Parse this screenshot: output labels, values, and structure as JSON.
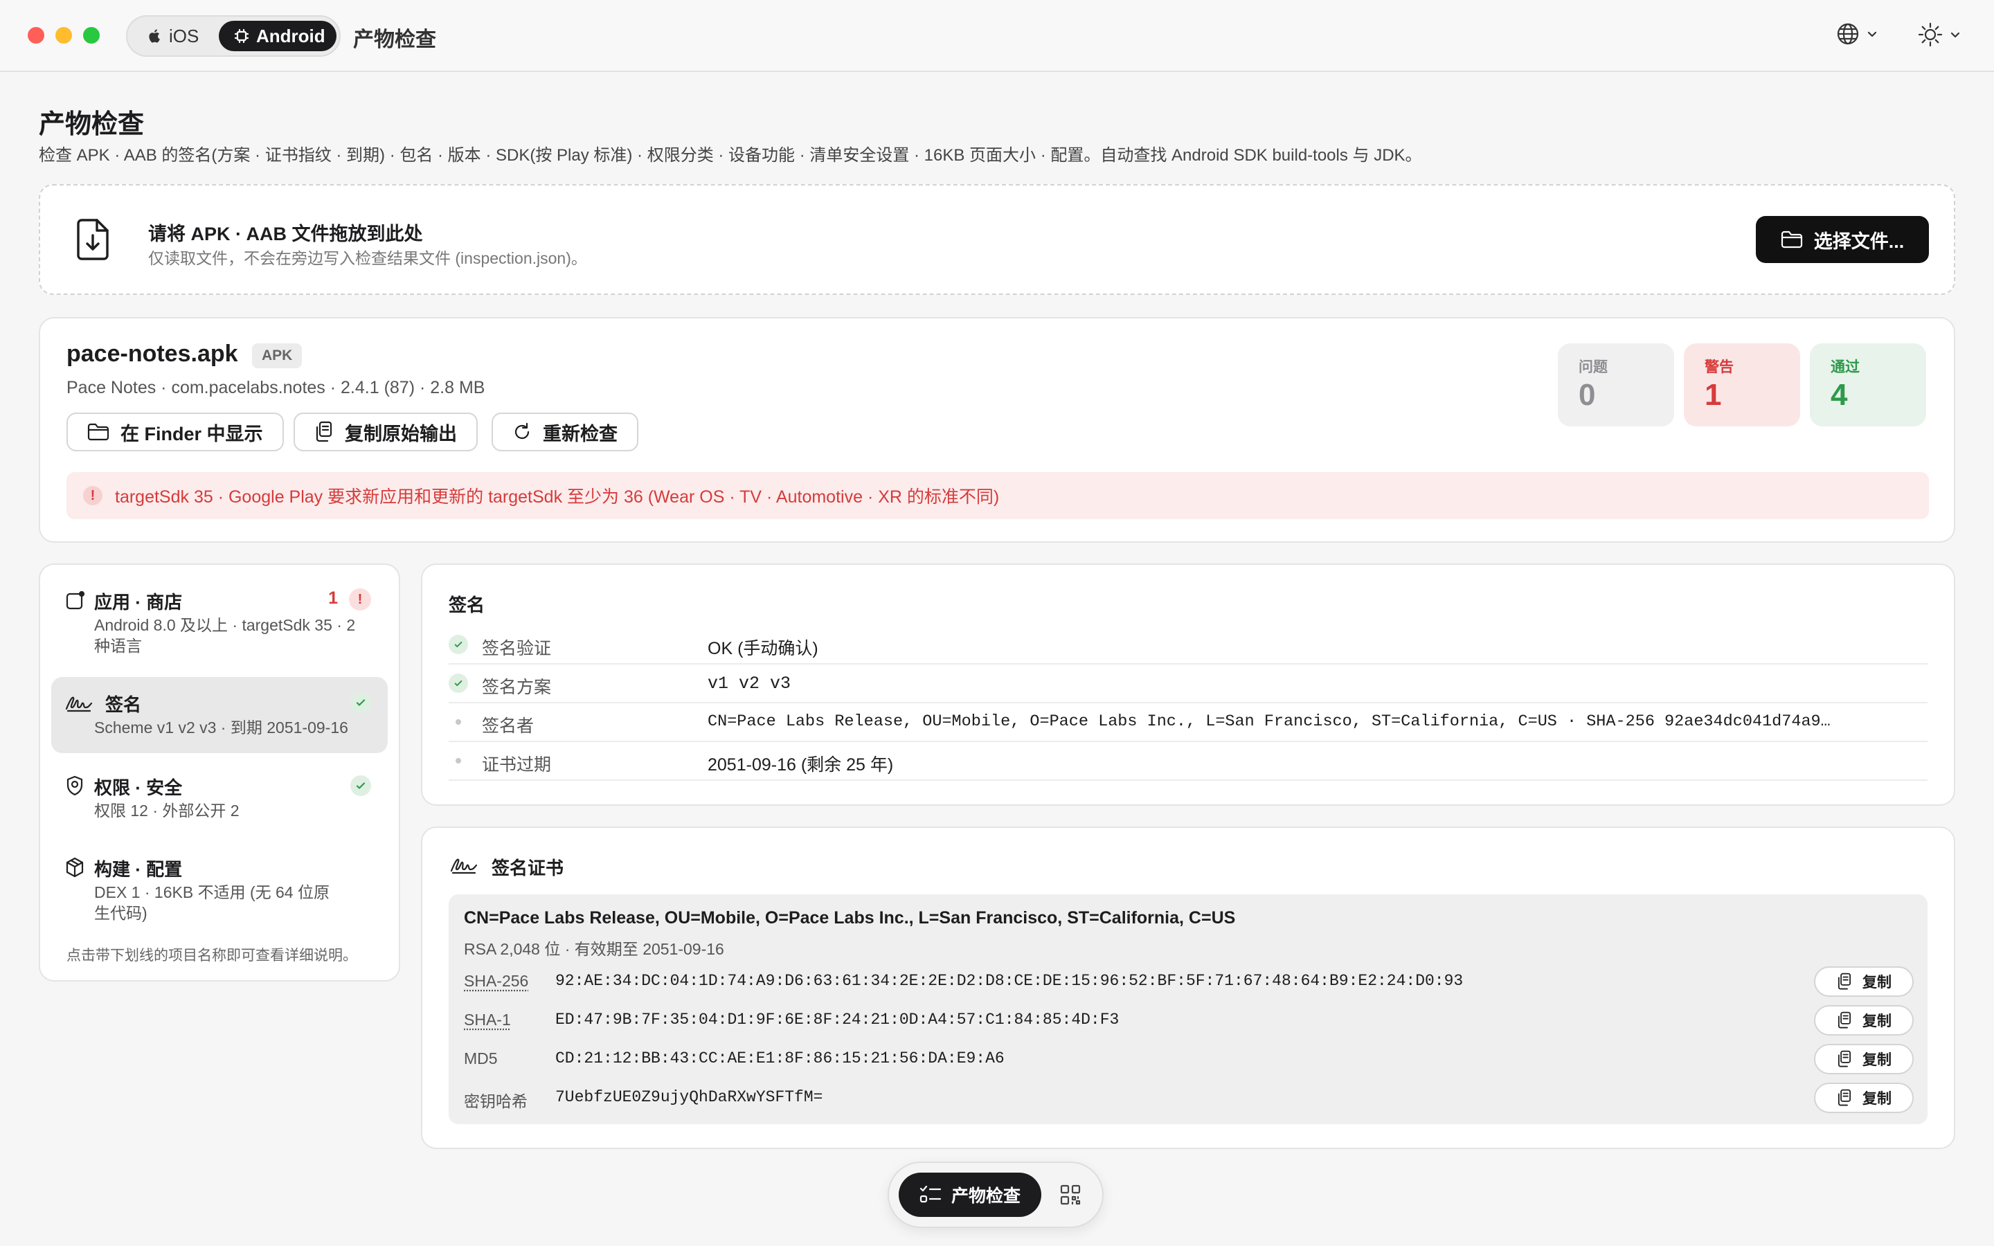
{
  "titlebar": {
    "platforms": [
      {
        "label": "iOS"
      },
      {
        "label": "Android"
      }
    ],
    "active_platform": "Android",
    "title": "产物检查"
  },
  "header": {
    "title": "产物检查",
    "subtitle": "检查 APK · AAB 的签名(方案 · 证书指纹 · 到期) · 包名 · 版本 · SDK(按 Play 标准) · 权限分类 · 设备功能 · 清单安全设置 · 16KB 页面大小 · 配置。自动查找 Android SDK build-tools 与 JDK。"
  },
  "dropzone": {
    "title": "请将 APK · AAB 文件拖放到此处",
    "hint": "仅读取文件，不会在旁边写入检查结果文件 (inspection.json)。",
    "choose_label": "选择文件..."
  },
  "file": {
    "name": "pace-notes.apk",
    "badge": "APK",
    "meta": "Pace Notes · com.pacelabs.notes · 2.4.1 (87) · 2.8 MB",
    "actions": {
      "reveal": "在 Finder 中显示",
      "copy_raw": "复制原始输出",
      "recheck": "重新检查"
    },
    "stats": {
      "issues": {
        "label": "问题",
        "value": "0",
        "color": "#8e8e93"
      },
      "warnings": {
        "label": "警告",
        "value": "1",
        "color": "#d63b3b"
      },
      "passed": {
        "label": "通过",
        "value": "4",
        "color": "#2c9a4a"
      }
    },
    "alert": "targetSdk 35 · Google Play 要求新应用和更新的 targetSdk 至少为 36 (Wear OS · TV · Automotive · XR 的标准不同)"
  },
  "sidebar": {
    "items": [
      {
        "title": "应用 · 商店",
        "sub": "Android 8.0 及以上 · targetSdk 35 · 2 种语言",
        "badge_count": "1",
        "status": "warning",
        "icon": "app-store-icon"
      },
      {
        "title": "签名",
        "sub": "Scheme v1 v2 v3 · 到期 2051-09-16",
        "status": "ok",
        "icon": "signature-icon"
      },
      {
        "title": "权限 · 安全",
        "sub": "权限 12 · 外部公开 2",
        "status": "ok",
        "icon": "shield-icon"
      },
      {
        "title": "构建 · 配置",
        "sub": "DEX 1 · 16KB 不适用 (无 64 位原生代码)",
        "status": "none",
        "icon": "box-icon"
      }
    ],
    "footer": "点击带下划线的项目名称即可查看详细说明。"
  },
  "signature": {
    "heading": "签名",
    "rows": [
      {
        "key": "签名验证",
        "value": "OK (手动确认)",
        "status": "ok"
      },
      {
        "key": "签名方案",
        "value": "v1  v2  v3",
        "status": "ok"
      },
      {
        "key": "签名者",
        "value": "CN=Pace Labs Release, OU=Mobile, O=Pace Labs Inc., L=San Francisco, ST=California, C=US · SHA-256 92ae34dc041d74a9…",
        "status": "info"
      },
      {
        "key": "证书过期",
        "value": "2051-09-16 (剩余 25 年)",
        "status": "info"
      }
    ]
  },
  "certificate": {
    "heading": "签名证书",
    "subject": "CN=Pace Labs Release, OU=Mobile, O=Pace Labs Inc., L=San Francisco, ST=California, C=US",
    "info": "RSA 2,048 位 · 有效期至 2051-09-16",
    "copy_label": "复制",
    "fingerprints": [
      {
        "key": "SHA-256",
        "value": "92:AE:34:DC:04:1D:74:A9:D6:63:61:34:2E:2E:D2:D8:CE:DE:15:96:52:BF:5F:71:67:48:64:B9:E2:24:D0:93"
      },
      {
        "key": "SHA-1",
        "value": "ED:47:9B:7F:35:04:D1:9F:6E:8F:24:21:0D:A4:57:C1:84:85:4D:F3"
      },
      {
        "key": "MD5",
        "value": "CD:21:12:BB:43:CC:AE:E1:8F:86:15:21:56:DA:E9:A6"
      },
      {
        "key": "密钥哈希",
        "value": "7UebfzUE0Z9ujyQhDaRXwYSFTfM="
      }
    ]
  },
  "bottombar": {
    "main_label": "产物检查"
  }
}
